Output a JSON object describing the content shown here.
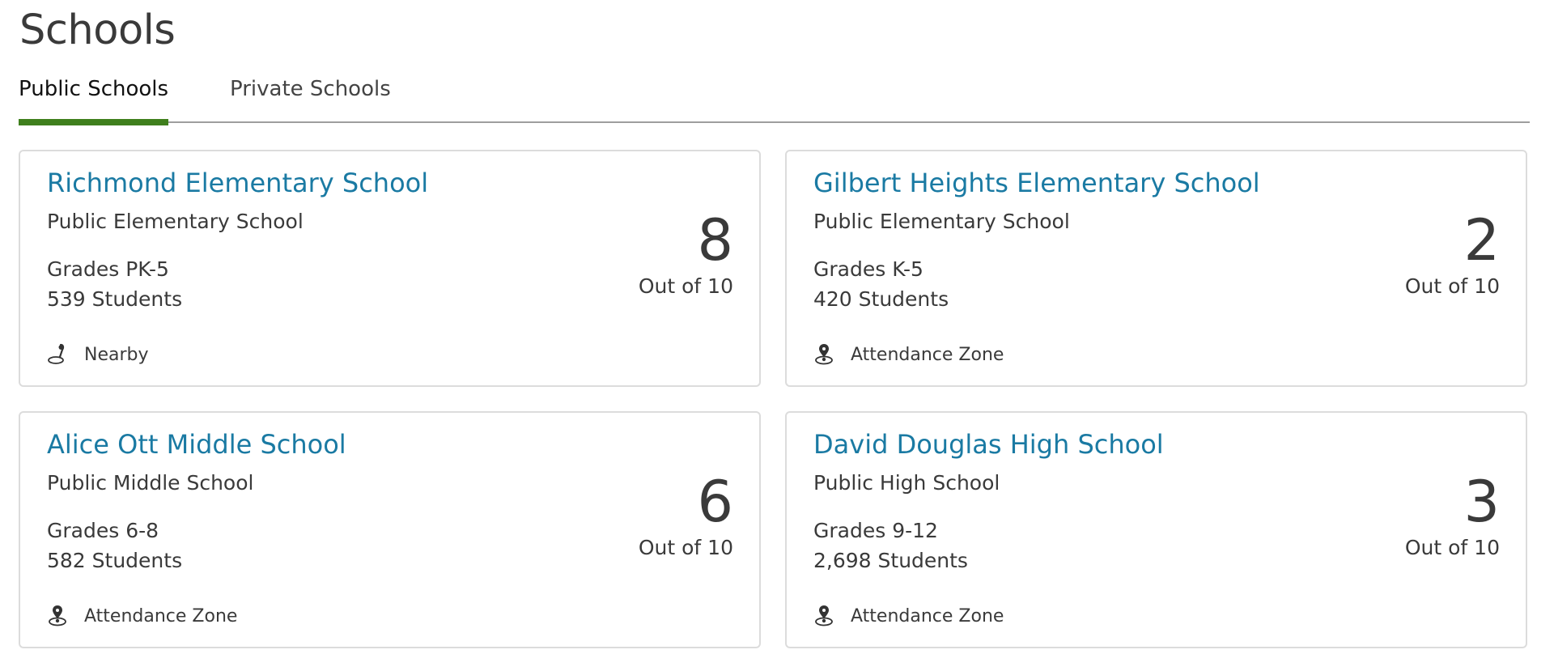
{
  "page": {
    "title": "Schools"
  },
  "tabs": [
    {
      "label": "Public Schools",
      "active": true
    },
    {
      "label": "Private Schools",
      "active": false
    }
  ],
  "colors": {
    "link": "#1a7aa3",
    "active_tab_underline": "#3f7f1d",
    "text": "#3a3a3a",
    "card_border": "#dcdcdc"
  },
  "schools": [
    {
      "name": "Richmond Elementary School",
      "type": "Public Elementary School",
      "grades": "Grades PK-5",
      "students": "539 Students",
      "rating": "8",
      "out_of": "Out of 10",
      "zone_label": "Nearby",
      "zone_icon": "nearby-icon"
    },
    {
      "name": "Gilbert Heights Elementary School",
      "type": "Public Elementary School",
      "grades": "Grades K-5",
      "students": "420 Students",
      "rating": "2",
      "out_of": "Out of 10",
      "zone_label": "Attendance Zone",
      "zone_icon": "attendance-zone-icon"
    },
    {
      "name": "Alice Ott Middle School",
      "type": "Public Middle School",
      "grades": "Grades 6-8",
      "students": "582 Students",
      "rating": "6",
      "out_of": "Out of 10",
      "zone_label": "Attendance Zone",
      "zone_icon": "attendance-zone-icon"
    },
    {
      "name": "David Douglas High School",
      "type": "Public High School",
      "grades": "Grades 9-12",
      "students": "2,698 Students",
      "rating": "3",
      "out_of": "Out of 10",
      "zone_label": "Attendance Zone",
      "zone_icon": "attendance-zone-icon"
    }
  ]
}
